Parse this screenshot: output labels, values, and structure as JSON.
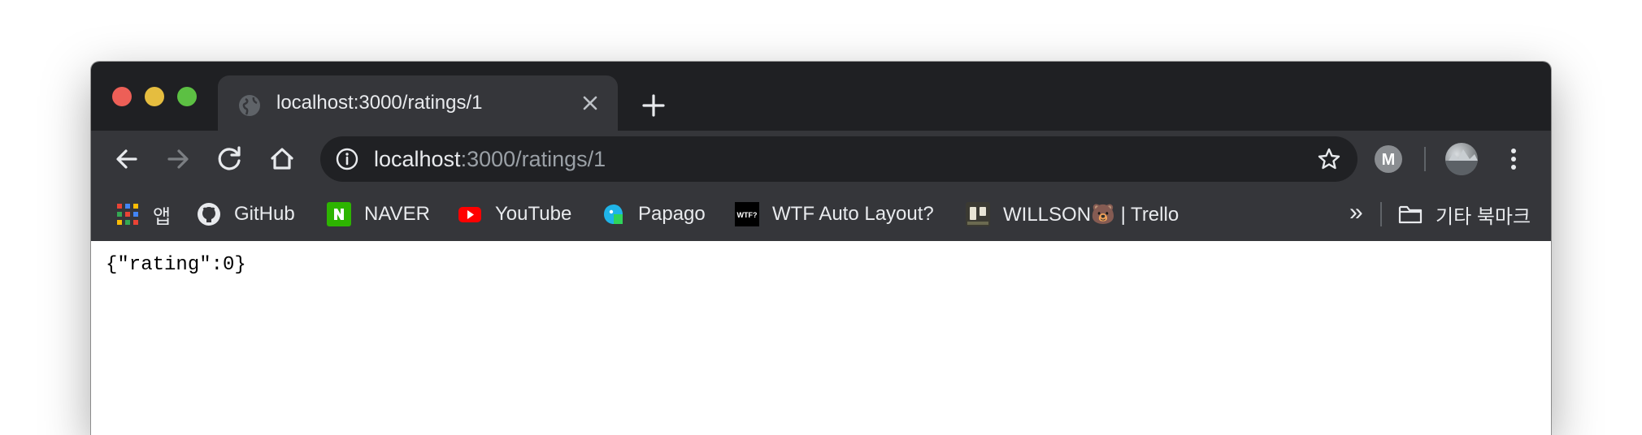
{
  "colors": {
    "titlebar": "#1f2023",
    "toolbar": "#35363a",
    "omnibox": "#202124",
    "text_light": "#e8eaed",
    "text_dim": "#9aa0a6",
    "close": "#ed5f57",
    "minimize": "#e5bd3f",
    "maximize": "#5cc043"
  },
  "tab": {
    "title": "localhost:3000/ratings/1",
    "favicon": "globe-icon"
  },
  "omnibox": {
    "url_host": "localhost",
    "url_path": ":3000/ratings/1"
  },
  "extension": {
    "letter": "M"
  },
  "bookmarks": [
    {
      "label": "앱",
      "icon": "apps-grid-icon"
    },
    {
      "label": "GitHub",
      "icon": "github-icon"
    },
    {
      "label": "NAVER",
      "icon": "naver-icon"
    },
    {
      "label": "YouTube",
      "icon": "youtube-icon"
    },
    {
      "label": "Papago",
      "icon": "papago-icon"
    },
    {
      "label": "WTF Auto Layout?",
      "icon": "wtf-icon",
      "icon_text": "WTF?"
    },
    {
      "label": "WILLSON🐻  | Trello",
      "icon": "trello-icon"
    }
  ],
  "bookmarks_more": "»",
  "other_bookmarks": {
    "label": "기타 북마크",
    "icon": "folder-icon"
  },
  "page": {
    "body_text": "{\"rating\":0}"
  }
}
